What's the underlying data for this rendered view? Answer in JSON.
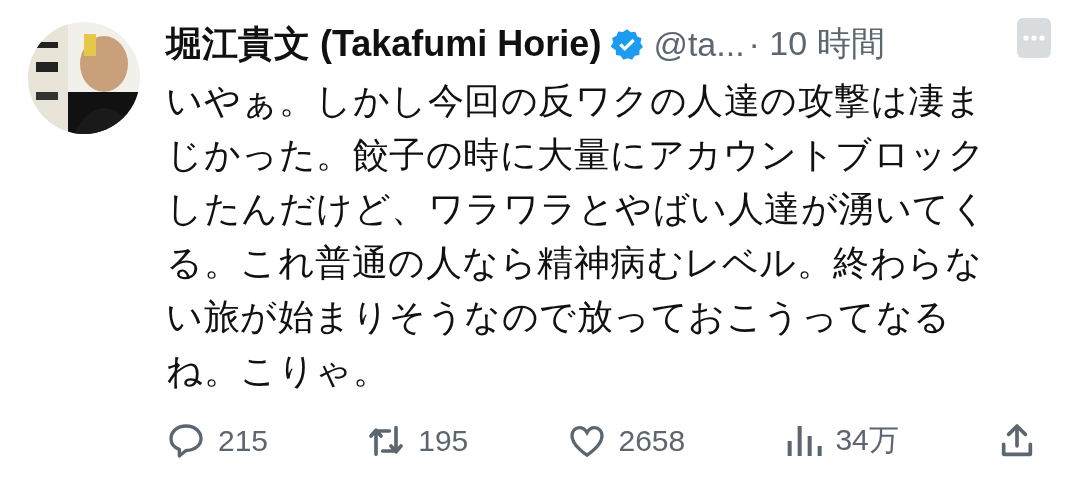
{
  "tweet": {
    "author": {
      "name": "堀江貴文 (Takafumi Horie)",
      "verified": true,
      "handle": "@ta...",
      "time": "· 10 時間"
    },
    "text_lines": [
      "いやぁ。しかし今回の反ワクの人達の攻撃は凄ま",
      "じかった。餃子の時に大量にアカウントブロック",
      "したんだけど、ワラワラとやばい人達が湧いてく",
      "る。これ普通の人なら精神病むレベル。終わらな",
      "い旅が始まりそうなので放っておこうってなる",
      "ね。こりゃ。"
    ],
    "actions": [
      {
        "kind": "reply",
        "count": "215"
      },
      {
        "kind": "retweet",
        "count": "195"
      },
      {
        "kind": "like",
        "count": "2658"
      },
      {
        "kind": "views",
        "count": "34万"
      },
      {
        "kind": "share"
      }
    ]
  }
}
